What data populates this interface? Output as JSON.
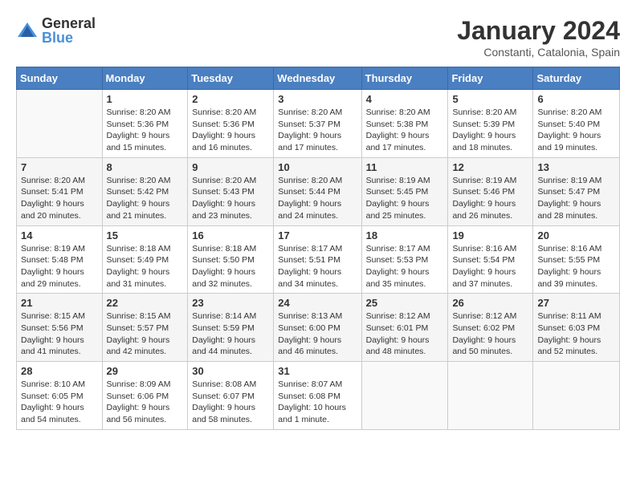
{
  "header": {
    "logo_general": "General",
    "logo_blue": "Blue",
    "month_year": "January 2024",
    "location": "Constanti, Catalonia, Spain"
  },
  "days_of_week": [
    "Sunday",
    "Monday",
    "Tuesday",
    "Wednesday",
    "Thursday",
    "Friday",
    "Saturday"
  ],
  "weeks": [
    [
      {
        "day": "",
        "sunrise": "",
        "sunset": "",
        "daylight": ""
      },
      {
        "day": "1",
        "sunrise": "Sunrise: 8:20 AM",
        "sunset": "Sunset: 5:36 PM",
        "daylight": "Daylight: 9 hours and 15 minutes."
      },
      {
        "day": "2",
        "sunrise": "Sunrise: 8:20 AM",
        "sunset": "Sunset: 5:36 PM",
        "daylight": "Daylight: 9 hours and 16 minutes."
      },
      {
        "day": "3",
        "sunrise": "Sunrise: 8:20 AM",
        "sunset": "Sunset: 5:37 PM",
        "daylight": "Daylight: 9 hours and 17 minutes."
      },
      {
        "day": "4",
        "sunrise": "Sunrise: 8:20 AM",
        "sunset": "Sunset: 5:38 PM",
        "daylight": "Daylight: 9 hours and 17 minutes."
      },
      {
        "day": "5",
        "sunrise": "Sunrise: 8:20 AM",
        "sunset": "Sunset: 5:39 PM",
        "daylight": "Daylight: 9 hours and 18 minutes."
      },
      {
        "day": "6",
        "sunrise": "Sunrise: 8:20 AM",
        "sunset": "Sunset: 5:40 PM",
        "daylight": "Daylight: 9 hours and 19 minutes."
      }
    ],
    [
      {
        "day": "7",
        "sunrise": "Sunrise: 8:20 AM",
        "sunset": "Sunset: 5:41 PM",
        "daylight": "Daylight: 9 hours and 20 minutes."
      },
      {
        "day": "8",
        "sunrise": "Sunrise: 8:20 AM",
        "sunset": "Sunset: 5:42 PM",
        "daylight": "Daylight: 9 hours and 21 minutes."
      },
      {
        "day": "9",
        "sunrise": "Sunrise: 8:20 AM",
        "sunset": "Sunset: 5:43 PM",
        "daylight": "Daylight: 9 hours and 23 minutes."
      },
      {
        "day": "10",
        "sunrise": "Sunrise: 8:20 AM",
        "sunset": "Sunset: 5:44 PM",
        "daylight": "Daylight: 9 hours and 24 minutes."
      },
      {
        "day": "11",
        "sunrise": "Sunrise: 8:19 AM",
        "sunset": "Sunset: 5:45 PM",
        "daylight": "Daylight: 9 hours and 25 minutes."
      },
      {
        "day": "12",
        "sunrise": "Sunrise: 8:19 AM",
        "sunset": "Sunset: 5:46 PM",
        "daylight": "Daylight: 9 hours and 26 minutes."
      },
      {
        "day": "13",
        "sunrise": "Sunrise: 8:19 AM",
        "sunset": "Sunset: 5:47 PM",
        "daylight": "Daylight: 9 hours and 28 minutes."
      }
    ],
    [
      {
        "day": "14",
        "sunrise": "Sunrise: 8:19 AM",
        "sunset": "Sunset: 5:48 PM",
        "daylight": "Daylight: 9 hours and 29 minutes."
      },
      {
        "day": "15",
        "sunrise": "Sunrise: 8:18 AM",
        "sunset": "Sunset: 5:49 PM",
        "daylight": "Daylight: 9 hours and 31 minutes."
      },
      {
        "day": "16",
        "sunrise": "Sunrise: 8:18 AM",
        "sunset": "Sunset: 5:50 PM",
        "daylight": "Daylight: 9 hours and 32 minutes."
      },
      {
        "day": "17",
        "sunrise": "Sunrise: 8:17 AM",
        "sunset": "Sunset: 5:51 PM",
        "daylight": "Daylight: 9 hours and 34 minutes."
      },
      {
        "day": "18",
        "sunrise": "Sunrise: 8:17 AM",
        "sunset": "Sunset: 5:53 PM",
        "daylight": "Daylight: 9 hours and 35 minutes."
      },
      {
        "day": "19",
        "sunrise": "Sunrise: 8:16 AM",
        "sunset": "Sunset: 5:54 PM",
        "daylight": "Daylight: 9 hours and 37 minutes."
      },
      {
        "day": "20",
        "sunrise": "Sunrise: 8:16 AM",
        "sunset": "Sunset: 5:55 PM",
        "daylight": "Daylight: 9 hours and 39 minutes."
      }
    ],
    [
      {
        "day": "21",
        "sunrise": "Sunrise: 8:15 AM",
        "sunset": "Sunset: 5:56 PM",
        "daylight": "Daylight: 9 hours and 41 minutes."
      },
      {
        "day": "22",
        "sunrise": "Sunrise: 8:15 AM",
        "sunset": "Sunset: 5:57 PM",
        "daylight": "Daylight: 9 hours and 42 minutes."
      },
      {
        "day": "23",
        "sunrise": "Sunrise: 8:14 AM",
        "sunset": "Sunset: 5:59 PM",
        "daylight": "Daylight: 9 hours and 44 minutes."
      },
      {
        "day": "24",
        "sunrise": "Sunrise: 8:13 AM",
        "sunset": "Sunset: 6:00 PM",
        "daylight": "Daylight: 9 hours and 46 minutes."
      },
      {
        "day": "25",
        "sunrise": "Sunrise: 8:12 AM",
        "sunset": "Sunset: 6:01 PM",
        "daylight": "Daylight: 9 hours and 48 minutes."
      },
      {
        "day": "26",
        "sunrise": "Sunrise: 8:12 AM",
        "sunset": "Sunset: 6:02 PM",
        "daylight": "Daylight: 9 hours and 50 minutes."
      },
      {
        "day": "27",
        "sunrise": "Sunrise: 8:11 AM",
        "sunset": "Sunset: 6:03 PM",
        "daylight": "Daylight: 9 hours and 52 minutes."
      }
    ],
    [
      {
        "day": "28",
        "sunrise": "Sunrise: 8:10 AM",
        "sunset": "Sunset: 6:05 PM",
        "daylight": "Daylight: 9 hours and 54 minutes."
      },
      {
        "day": "29",
        "sunrise": "Sunrise: 8:09 AM",
        "sunset": "Sunset: 6:06 PM",
        "daylight": "Daylight: 9 hours and 56 minutes."
      },
      {
        "day": "30",
        "sunrise": "Sunrise: 8:08 AM",
        "sunset": "Sunset: 6:07 PM",
        "daylight": "Daylight: 9 hours and 58 minutes."
      },
      {
        "day": "31",
        "sunrise": "Sunrise: 8:07 AM",
        "sunset": "Sunset: 6:08 PM",
        "daylight": "Daylight: 10 hours and 1 minute."
      },
      {
        "day": "",
        "sunrise": "",
        "sunset": "",
        "daylight": ""
      },
      {
        "day": "",
        "sunrise": "",
        "sunset": "",
        "daylight": ""
      },
      {
        "day": "",
        "sunrise": "",
        "sunset": "",
        "daylight": ""
      }
    ]
  ]
}
